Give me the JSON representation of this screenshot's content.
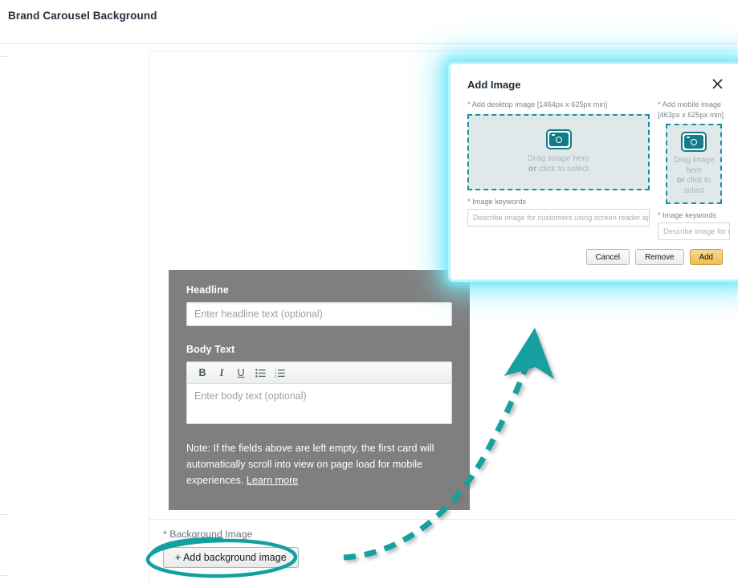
{
  "page": {
    "title": "Brand Carousel Background"
  },
  "card": {
    "headline_label": "Headline",
    "headline_placeholder": "Enter headline text (optional)",
    "body_label": "Body Text",
    "body_placeholder": "Enter body text (optional)",
    "toolbar": {
      "bold": "B",
      "italic": "I",
      "underline": "U",
      "bullet_list": "bulleted-list-icon",
      "numbered_list": "numbered-list-icon"
    },
    "note_text": "Note: If the fields above are left empty, the first card will automatically scroll into view on page load for mobile experiences.",
    "note_link": "Learn more"
  },
  "background_section": {
    "label": "* Background Image",
    "add_button": "+ Add background image"
  },
  "modal": {
    "title": "Add Image",
    "close_icon": "close-icon",
    "desktop": {
      "label": "* Add desktop image [1464px x 625px min]",
      "dropzone_line1": "Drag image here",
      "dropzone_line2_strong": "or",
      "dropzone_line2_rest": " click to select",
      "camera_icon": "camera-icon",
      "keywords_label": "* Image keywords",
      "keywords_placeholder": "Describe image for customers using screen reader application"
    },
    "mobile": {
      "label": "* Add mobile image [463px x 625px min]",
      "dropzone_line1": "Drag image",
      "dropzone_line2": "here",
      "dropzone_line3_strong": "or",
      "dropzone_line3_rest": " click to",
      "dropzone_line4": "select",
      "camera_icon": "camera-icon",
      "keywords_label": "* Image keywords",
      "keywords_placeholder": "Describe image for cust"
    },
    "buttons": {
      "cancel": "Cancel",
      "remove": "Remove",
      "add": "Add"
    }
  },
  "annotations": {
    "accent_color": "#12a0a0",
    "glow_color": "#7fe9f7",
    "arrow": "curved-dashed-arrow-pointing-to-modal",
    "ellipse": "highlight-ellipse-around-add-background-image-button"
  },
  "colors": {
    "card_gray": "#807f7f",
    "teal": "#12a0a0",
    "dropzone_fill": "#e1e8ea",
    "dropzone_border": "#1a8f9e",
    "primary_button": "#eebe55",
    "title_text": "#232f3e"
  }
}
